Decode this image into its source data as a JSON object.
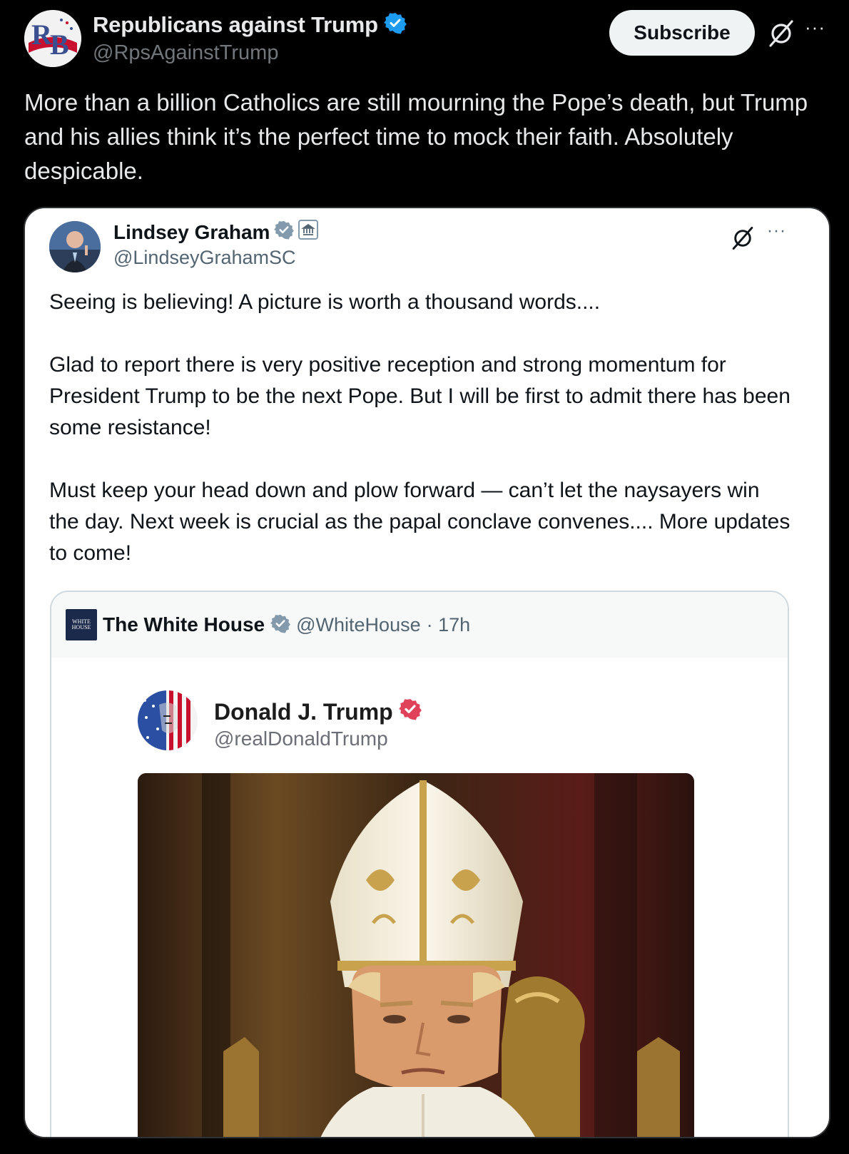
{
  "outer_post": {
    "author_name": "Republicans against Trump",
    "author_handle": "@RpsAgainstTrump",
    "avatar_initials": "RB",
    "subscribe_label": "Subscribe",
    "more_label": "···",
    "text": "More than a billion Catholics are still mourning the Pope’s death, but Trump and his allies think it’s the perfect time to mock their faith. Absolutely despicable."
  },
  "quoted_post": {
    "author_name": "Lindsey Graham",
    "author_handle": "@LindseyGrahamSC",
    "more_label": "···",
    "paragraphs": [
      "Seeing is believing! A picture is worth a thousand words....",
      "Glad to report there is very positive reception and strong momentum for President Trump to be the next Pope. But I will be first to admit there has been some resistance!",
      "Must keep your head down and plow forward — can’t let the naysayers win the day. Next week is crucial as the papal conclave convenes.... More updates to come!"
    ]
  },
  "nested_post": {
    "author_name": "The White House",
    "author_handle": "@WhiteHouse",
    "time": "· 17h",
    "logo_text_1": "WHITE",
    "logo_text_2": "HOUSE",
    "embedded": {
      "author_name": "Donald J. Trump",
      "author_handle": "@realDonaldTrump"
    }
  },
  "colors": {
    "background": "#000000",
    "verified_blue": "#1d9bf0",
    "verified_gray": "#829aab",
    "truth_badge_red": "#e0425a"
  }
}
